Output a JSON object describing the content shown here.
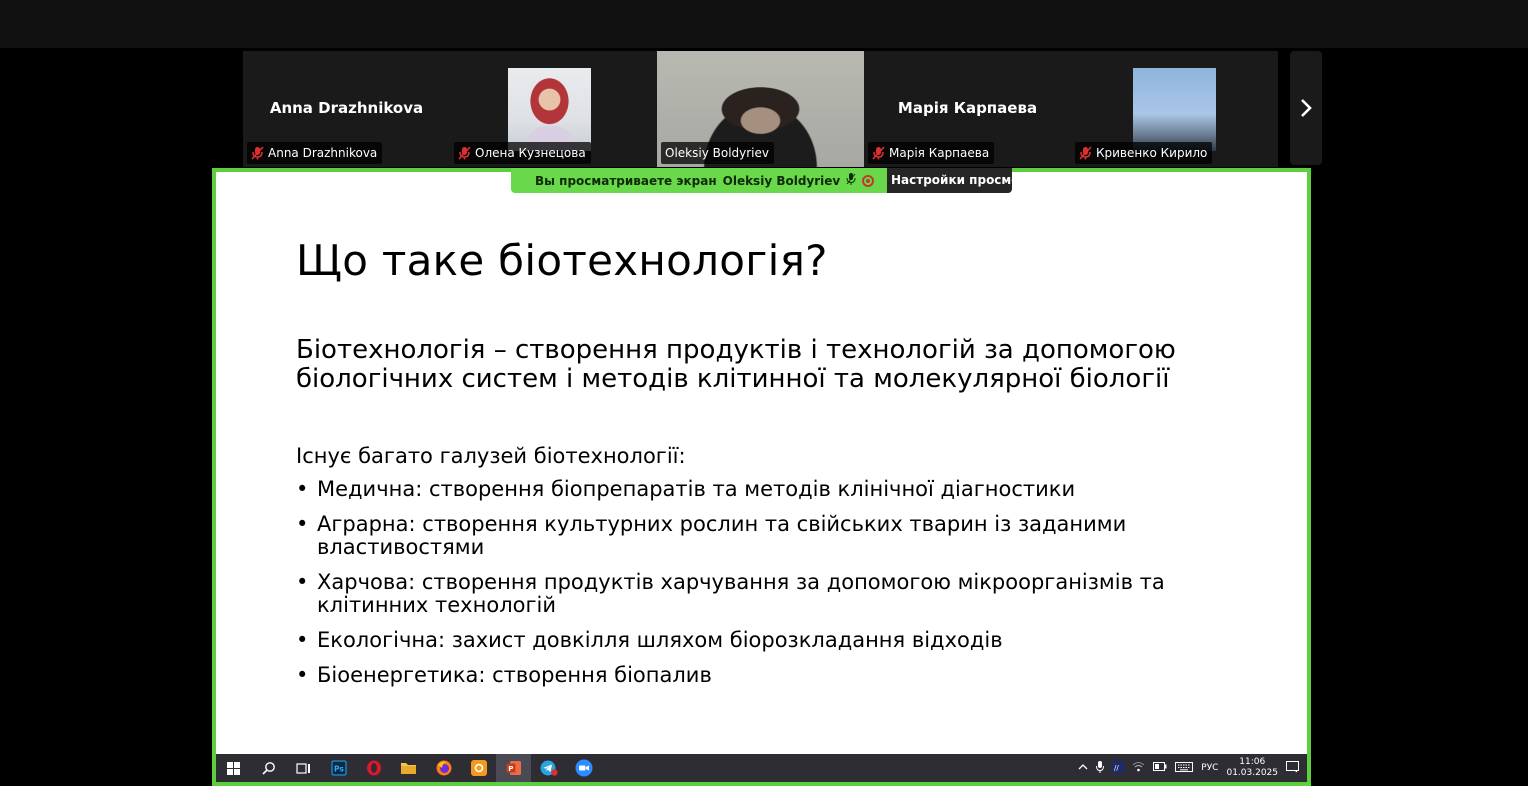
{
  "participants": [
    {
      "center_name": "Anna Drazhnikova",
      "label": "Anna Drazhnikova",
      "muted": true
    },
    {
      "center_name": "",
      "label": "Олена Кузнецова",
      "muted": true
    },
    {
      "center_name": "",
      "label": "Oleksiy Boldyriev",
      "muted": false
    },
    {
      "center_name": "Марія Карпаева",
      "label": "Марія Карпаева",
      "muted": true
    },
    {
      "center_name": "",
      "label": "Кривенко Кирило",
      "muted": true
    }
  ],
  "share_bar": {
    "viewing_text": "Вы просматриваете экран",
    "presenter": "Oleksiy Boldyriev",
    "settings_label": "Настройки просмотра"
  },
  "slide": {
    "title": "Що таке біотехнологія?",
    "definition": "Біотехнологія – створення продуктів і технологій за допомогою біологічних систем і методів клітинної та молекулярної біології",
    "subtitle": "Існує багато галузей біотехнології:",
    "bullets": [
      "Медична: створення біопрепаратів та методів клінічної діагностики",
      "Аграрна: створення культурних рослин та свійських тварин із заданими властивостями",
      "Харчова: створення продуктів харчування за допомогою мікроорганізмів та клітинних технологій",
      "Екологічна: захист довкілля шляхом біорозкладання відходів",
      "Біоенергетика: створення біопалив"
    ]
  },
  "taskbar": {
    "apps": [
      "windows-start-icon",
      "search-icon",
      "task-view-icon",
      "photoshop-icon",
      "opera-icon",
      "file-explorer-icon",
      "firefox-icon",
      "app-orange-icon",
      "powerpoint-icon",
      "telegram-icon",
      "zoom-icon"
    ],
    "language": "РУС",
    "time": "11:06",
    "date": "01.03.2025"
  },
  "colors": {
    "share_border": "#5dcf3f",
    "share_pill": "#6ad84b",
    "tile_bg": "#1a1a1a",
    "mute_red": "#e02e2e"
  }
}
